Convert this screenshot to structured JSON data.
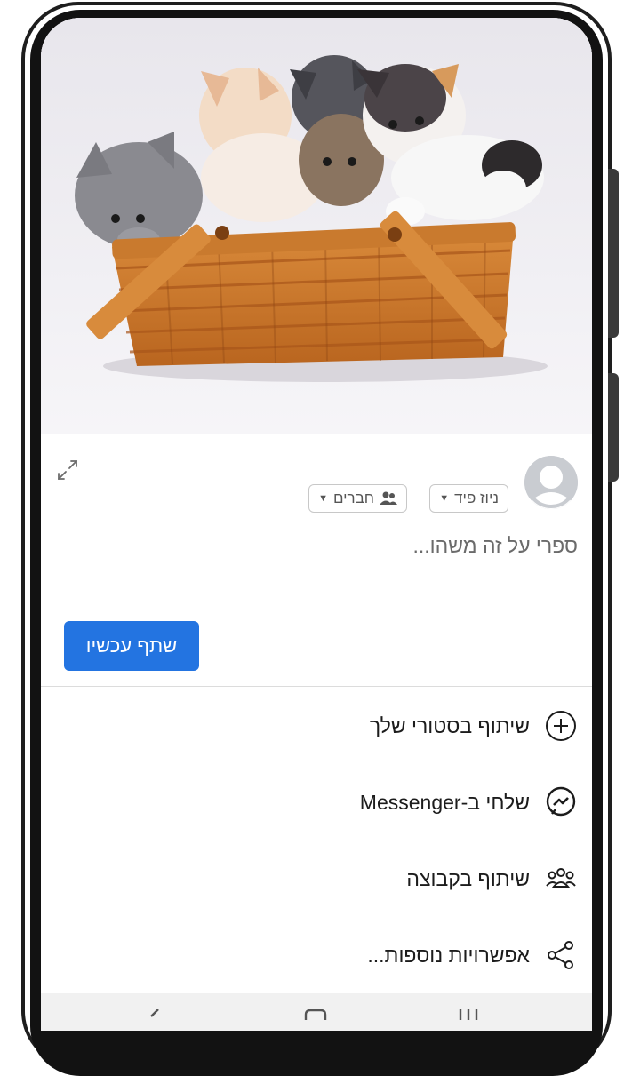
{
  "composer": {
    "audience_feed": "ניוז פיד",
    "audience_privacy": "חברים",
    "placeholder": "ספרי על זה משהו...",
    "share_button": "שתף עכשיו"
  },
  "share_options": [
    {
      "label": "שיתוף בסטורי שלך",
      "icon": "plus-circle-icon"
    },
    {
      "label": "שלחי ב-Messenger",
      "icon": "messenger-icon"
    },
    {
      "label": "שיתוף בקבוצה",
      "icon": "group-icon"
    },
    {
      "label": "אפשרויות נוספות...",
      "icon": "share-icon"
    }
  ],
  "colors": {
    "primary_button": "#2374e1",
    "background": "#ffffff"
  }
}
